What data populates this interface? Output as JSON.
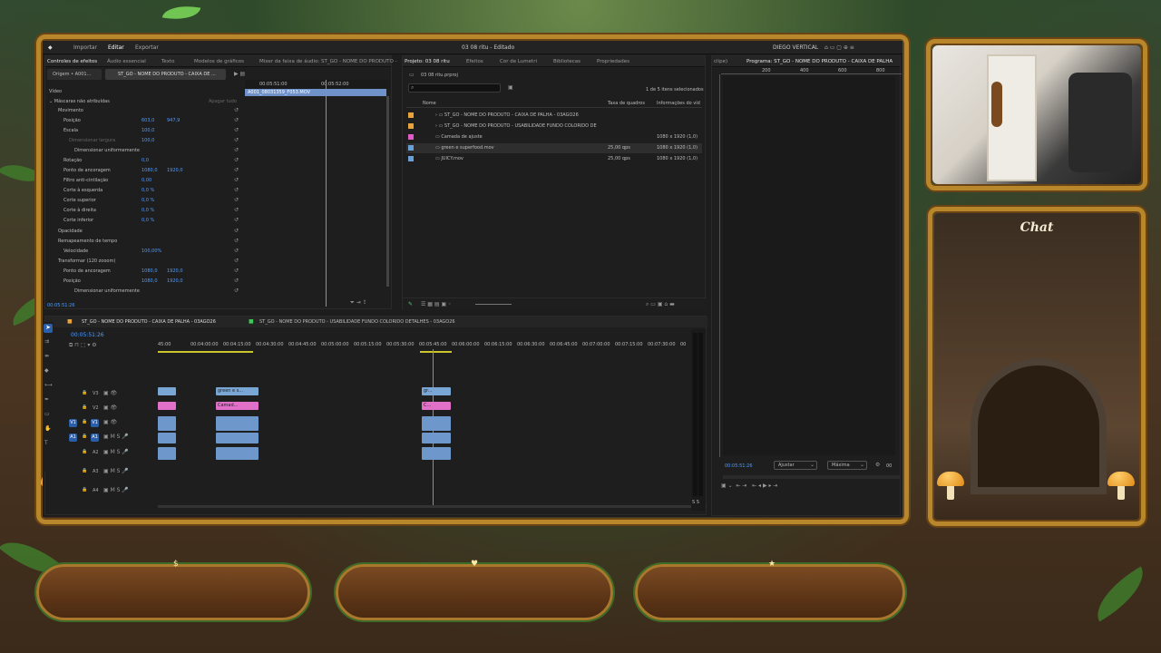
{
  "app": {
    "title": "03 08 ritu - Editado",
    "user": "DIEGO VERTICAL",
    "menu": [
      "Importar",
      "Editar",
      "Exportar"
    ]
  },
  "effects_panel": {
    "tabs": [
      "Controles de efeitos",
      "Áudio essencial",
      "Texto",
      "Modelos de gráficos",
      "Mixer da faixa de áudio: ST_GO - NOME DO PRODUTO -"
    ],
    "source_label": "Origem • A001...",
    "sequence_label": "ST_GO - NOME DO PRODUTO - CAIXA DE ...",
    "ruler": [
      "00:05:51:00",
      "00:05:52:00"
    ],
    "clip_name": "A001_08031359_F053.MOV",
    "video_label": "Vídeo",
    "mask_label": "Máscaras não atribuídas",
    "reset_all": "Apagar tudo",
    "rows": [
      {
        "label": "Movimento",
        "v1": "",
        "v2": ""
      },
      {
        "label": "Posição",
        "v1": "603,0",
        "v2": "947,9"
      },
      {
        "label": "Escala",
        "v1": "100,0",
        "v2": ""
      },
      {
        "label": "Dimensionar largura",
        "v1": "100,0",
        "v2": ""
      },
      {
        "label": "Dimensionar uniformemente",
        "v1": "",
        "v2": ""
      },
      {
        "label": "Rotação",
        "v1": "0,0",
        "v2": ""
      },
      {
        "label": "Ponto de ancoragem",
        "v1": "1080,0",
        "v2": "1920,0"
      },
      {
        "label": "Filtro anti-cintilação",
        "v1": "0,00",
        "v2": ""
      },
      {
        "label": "Corte à esquerda",
        "v1": "0,0 %",
        "v2": ""
      },
      {
        "label": "Corte superior",
        "v1": "0,0 %",
        "v2": ""
      },
      {
        "label": "Corte à direita",
        "v1": "0,0 %",
        "v2": ""
      },
      {
        "label": "Corte inferior",
        "v1": "0,0 %",
        "v2": ""
      },
      {
        "label": "Opacidade",
        "v1": "",
        "v2": ""
      },
      {
        "label": "Remapeamento de tempo",
        "v1": "",
        "v2": ""
      },
      {
        "label": "Velocidade",
        "v1": "100,00%",
        "v2": ""
      },
      {
        "label": "Transformar (120 zooom)",
        "v1": "",
        "v2": ""
      },
      {
        "label": "Ponto de ancoragem",
        "v1": "1080,0",
        "v2": "1920,0"
      },
      {
        "label": "Posição",
        "v1": "1080,0",
        "v2": "1920,0"
      },
      {
        "label": "Dimensionar uniformemente",
        "v1": "",
        "v2": ""
      }
    ],
    "timecode": "00:05:51:26"
  },
  "project_panel": {
    "tabs": [
      "Projeto: 03 08 ritu",
      "Efeitos",
      "Cor de Lumetri",
      "Bibliotecas",
      "Propriedades"
    ],
    "file": "03 08 ritu.prproj",
    "selection": "1 de 5 itens selecionados",
    "columns": [
      "Nome",
      "Taxa de quadros",
      "Informações do víd"
    ],
    "items": [
      {
        "name": "ST_GO - NOME DO PRODUTO - CAIXA DE PALHA - 03AGO26",
        "fps": "",
        "info": "",
        "color": "#e8a33a"
      },
      {
        "name": "ST_GO - NOME DO PRODUTO - USABILIDADE FUNDO COLORIDO DE",
        "fps": "",
        "info": "",
        "color": "#e8a33a"
      },
      {
        "name": "Camada de ajuste",
        "fps": "",
        "info": "1080 x 1920 (1,0)",
        "color": "#e05ac8"
      },
      {
        "name": "green e superfood.mov",
        "fps": "25,00 qps",
        "info": "1080 x 1920 (1,0)",
        "color": "#6aa0d8"
      },
      {
        "name": "JUICY.mov",
        "fps": "25,00 qps",
        "info": "1080 x 1920 (1,0)",
        "color": "#6aa0d8"
      }
    ]
  },
  "program_panel": {
    "tab_prefix": "clipe)",
    "title": "Programa: ST_GO - NOME DO PRODUTO - CAIXA DE PALHA",
    "ruler": [
      "200",
      "400",
      "600",
      "800",
      "1000"
    ],
    "timecode": "00:05:51:26",
    "fit": "Ajustar",
    "quality": "Máxima",
    "right_tc": "00"
  },
  "timeline": {
    "tabs": [
      "ST_GO - NOME DO PRODUTO - CAIXA DE PALHA - 03AGO26",
      "ST_GO - NOME DO PRODUTO - USABILIDADE FUNDO COLORIDO DETALHES - 03AGO26"
    ],
    "timecode": "00:05:51:26",
    "ruler": [
      "45:00",
      "00:04:00:00",
      "00:04:15:00",
      "00:04:30:00",
      "00:04:45:00",
      "00:05:00:00",
      "00:05:15:00",
      "00:05:30:00",
      "00:05:45:00",
      "00:06:00:00",
      "00:06:15:00",
      "00:06:30:00",
      "00:06:45:00",
      "00:07:00:00",
      "00:07:15:00",
      "00:07:30:00",
      "00"
    ],
    "tracks": [
      "V3",
      "V2",
      "V1",
      "A1",
      "A2",
      "A3",
      "A4"
    ],
    "clip_labels": [
      "green e s...",
      "Camad...",
      "gr...",
      "C..."
    ],
    "meter": [
      "0",
      "-6",
      "-12",
      "-18",
      "-24",
      "-30",
      "-36",
      "-42",
      "-48",
      "-54"
    ],
    "meter_bottom": "S S"
  },
  "chat": {
    "title": "Chat"
  }
}
